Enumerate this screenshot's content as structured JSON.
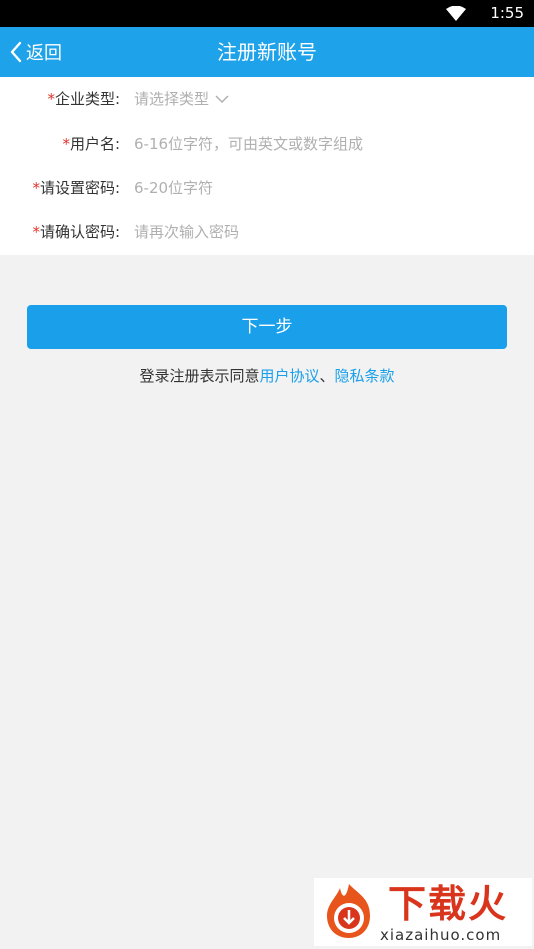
{
  "status_bar": {
    "time": "1:55",
    "wifi_icon": "wifi-icon"
  },
  "nav": {
    "back_label": "返回",
    "title": "注册新账号"
  },
  "form": {
    "required_mark": "*",
    "company_type": {
      "label": "企业类型:",
      "placeholder": "请选择类型"
    },
    "username": {
      "label": "用户名:",
      "placeholder": "6-16位字符，可由英文或数字组成"
    },
    "password": {
      "label": "请设置密码:",
      "placeholder": "6-20位字符"
    },
    "confirm_password": {
      "label": "请确认密码:",
      "placeholder": "请再次输入密码"
    }
  },
  "next_button": "下一步",
  "agreement": {
    "prefix": "登录注册表示同意",
    "user_agreement": "用户协议",
    "separator": "、",
    "privacy_policy": "隐私条款"
  },
  "watermark": {
    "brand": "下载火",
    "domain": "xiazaihuo.com"
  },
  "colors": {
    "primary": "#1ea2ea",
    "required": "#e0322b",
    "background": "#f2f2f2"
  }
}
